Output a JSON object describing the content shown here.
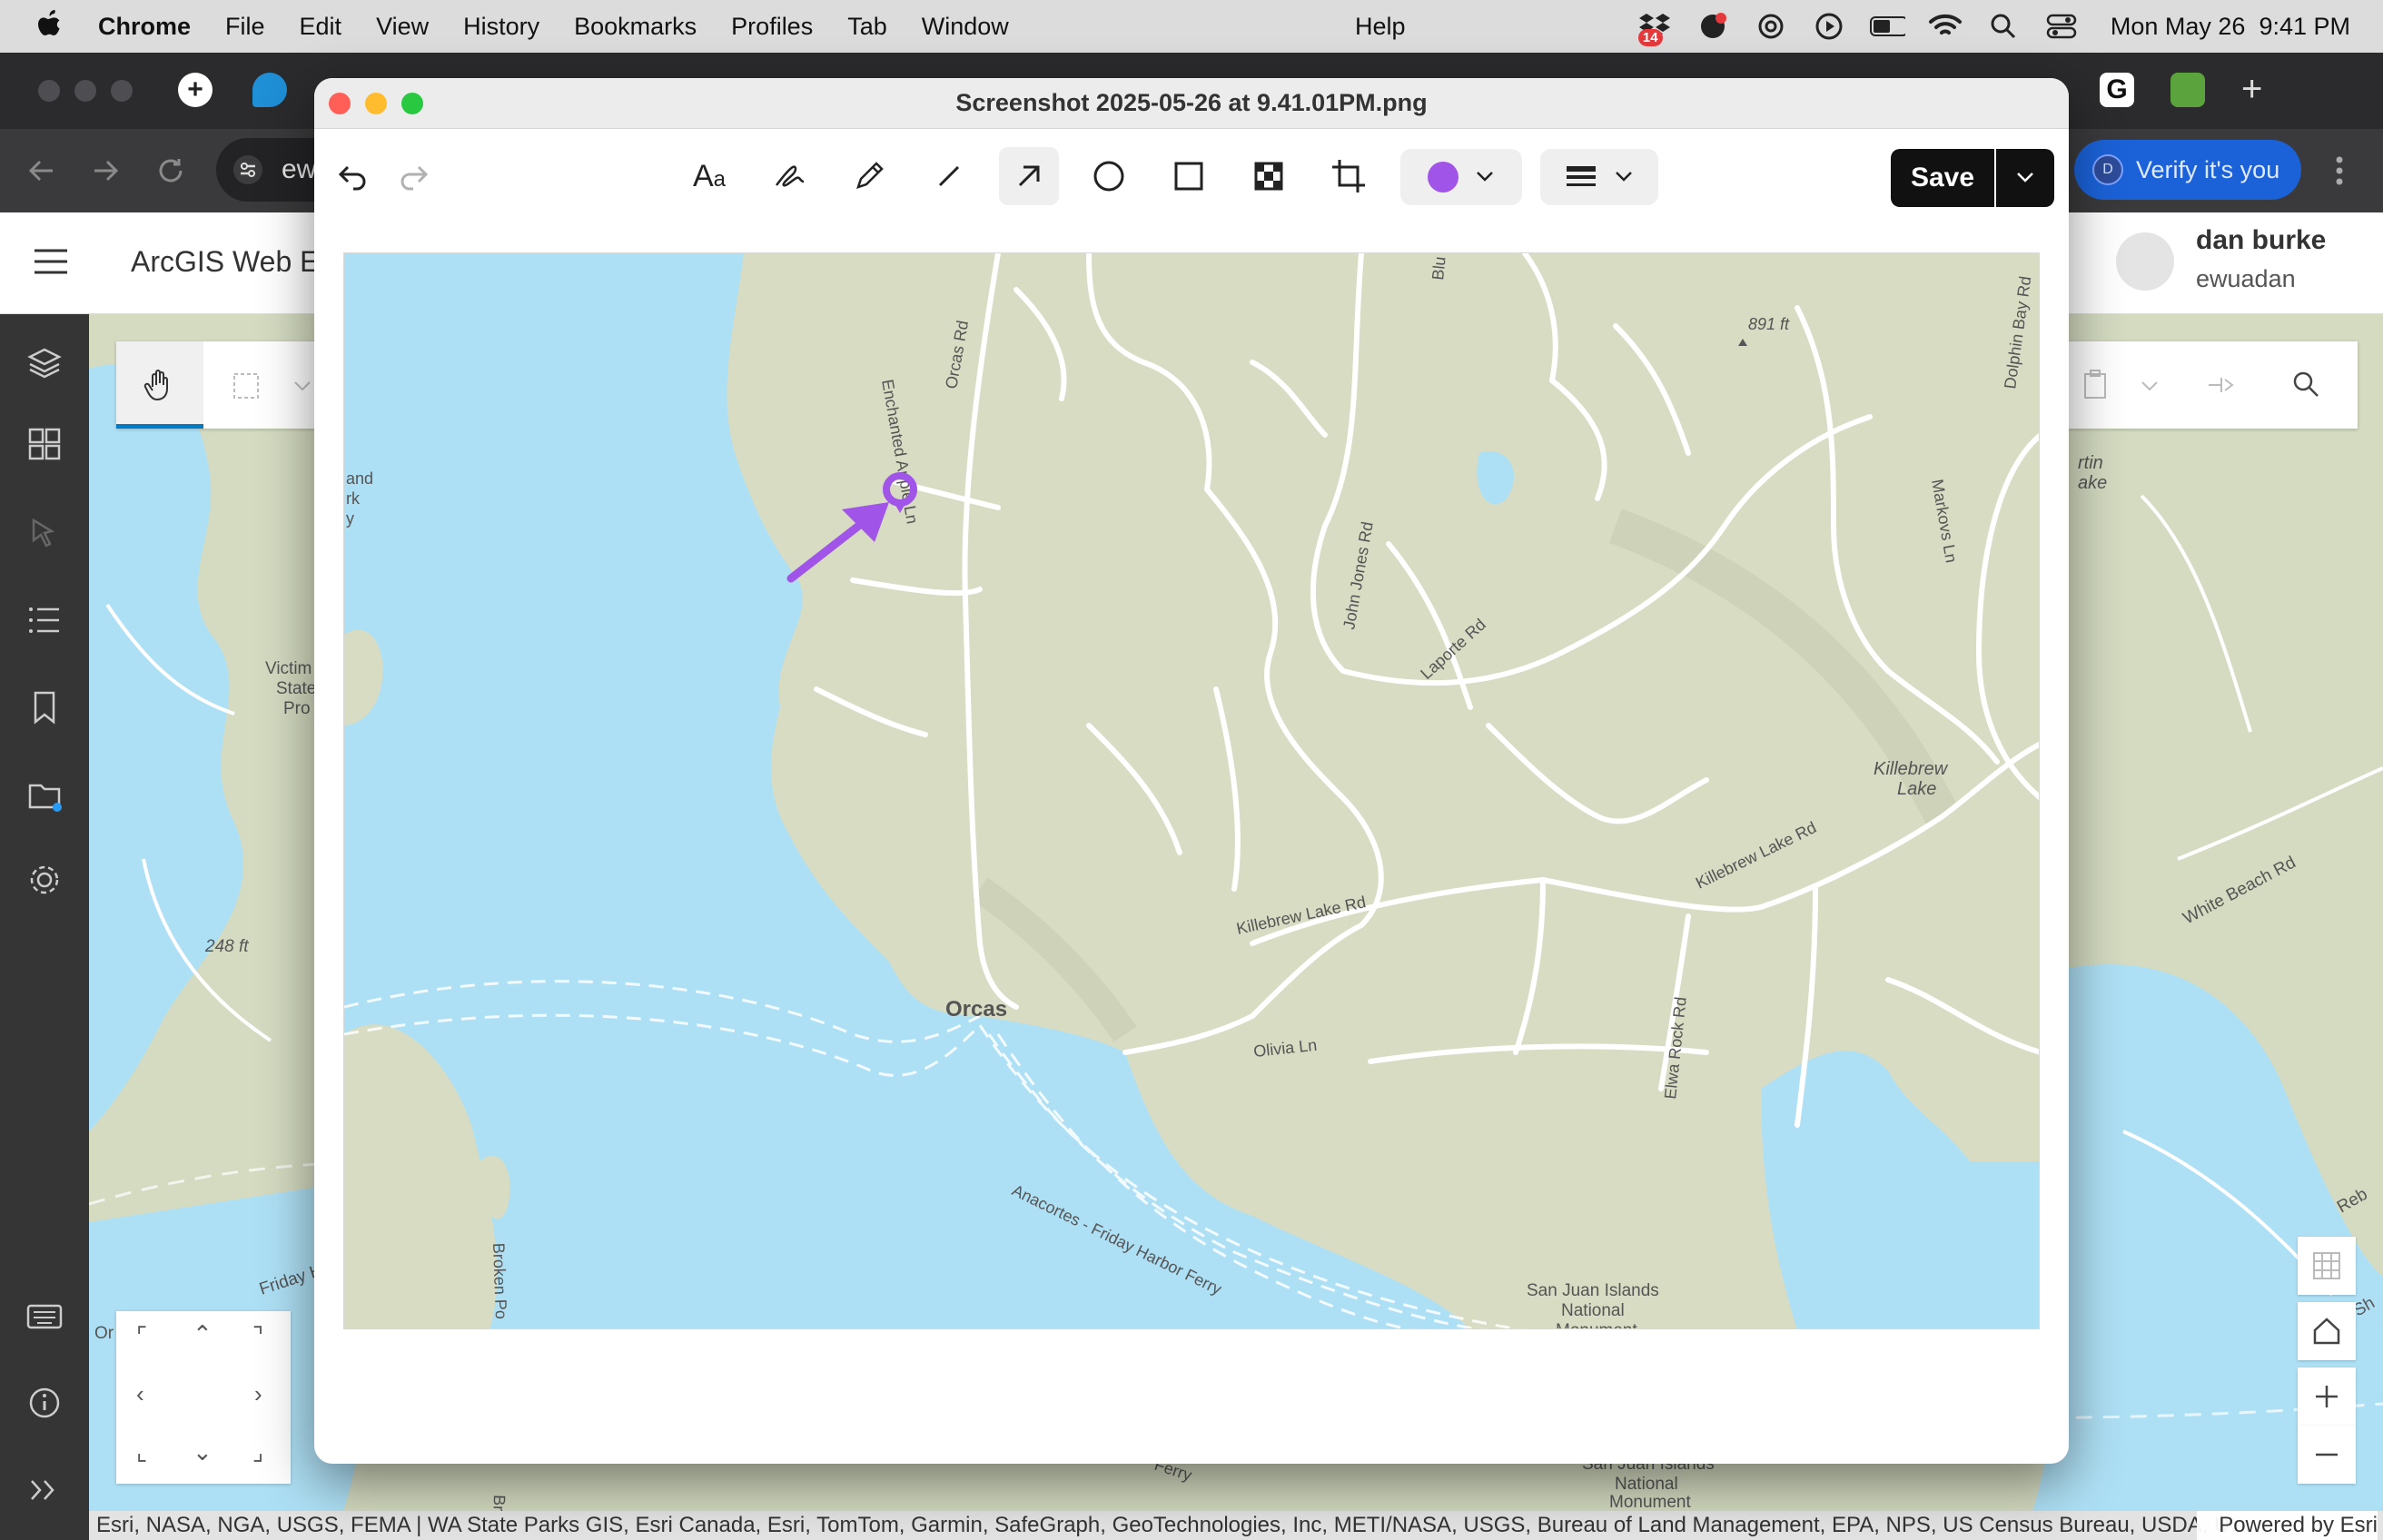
{
  "menubar": {
    "app_name": "Chrome",
    "items": [
      "File",
      "Edit",
      "View",
      "History",
      "Bookmarks",
      "Profiles",
      "Tab",
      "Window"
    ],
    "help": "Help",
    "notification_badge": "14",
    "datetime": "Mon May 26  9:41 PM"
  },
  "browser": {
    "omnibox_text": "ew",
    "verify_label": "Verify it's you",
    "profile_initial": "D"
  },
  "arcgis": {
    "app_title": "ArcGIS Web E",
    "user_name": "dan burke",
    "user_id": "ewuadan",
    "attribution": "Esri, NASA, NGA, USGS, FEMA | WA State Parks GIS, Esri Canada, Esri, TomTom, Garmin, SafeGraph, GeoTechnologies, Inc, METI/NASA, USGS, Bureau of Land Management, EPA, NPS, US Census Bureau, USDA, U…",
    "powered_by": "Powered by Esri",
    "bg_labels": {
      "victim": "Victim",
      "state": "State",
      "pro": "Pro",
      "elev248": "248 ft",
      "friday_harbor": "Friday Harbor",
      "martin": "rtin",
      "lake": "ake",
      "white_beach": "White Beach Rd",
      "reb": "Reb",
      "ferry": "Ferry",
      "san_juan_1": "San Juan Islands",
      "national": "National",
      "monument": "Monument",
      "broken_point": "Broken Po",
      "sh": "Sh",
      "or": "Or"
    }
  },
  "dialog": {
    "title": "Screenshot 2025-05-26 at 9.41.01PM.png",
    "save_label": "Save",
    "annotation_color": "#a054e8",
    "tools": [
      "undo-icon",
      "redo-icon",
      "text-icon",
      "signature-icon",
      "pencil-icon",
      "line-icon",
      "arrow-icon",
      "circle-icon",
      "rectangle-icon",
      "pixelate-icon",
      "crop-icon"
    ]
  },
  "map": {
    "place_orcas": "Orcas",
    "road_orcas": "Orcas Rd",
    "road_john_jones": "John Jones Rd",
    "road_laporte": "Laporte Rd",
    "road_killebrew_1": "Killebrew Lake Rd",
    "road_killebrew_2": "Killebrew Lake Rd",
    "road_olivia": "Olivia Ln",
    "road_elwa": "Elwa Rock Rd",
    "road_markovs": "Markovs Ln",
    "road_dolphin": "Dolphin Bay Rd",
    "road_enchanted": "Enchanted Apple Ln",
    "road_blue": "Blu",
    "killebrew_lake_1": "Killebrew",
    "killebrew_lake_2": "Lake",
    "elevation_891": "891 ft",
    "ferry_route": "Anacortes - Friday Harbor Ferry",
    "san_juan_1": "San Juan Islands",
    "san_juan_2": "National",
    "san_juan_3": "Monument",
    "left_label_1": "and",
    "left_label_2": "rk",
    "left_label_3": "y",
    "broken_point": "Broken Po"
  }
}
